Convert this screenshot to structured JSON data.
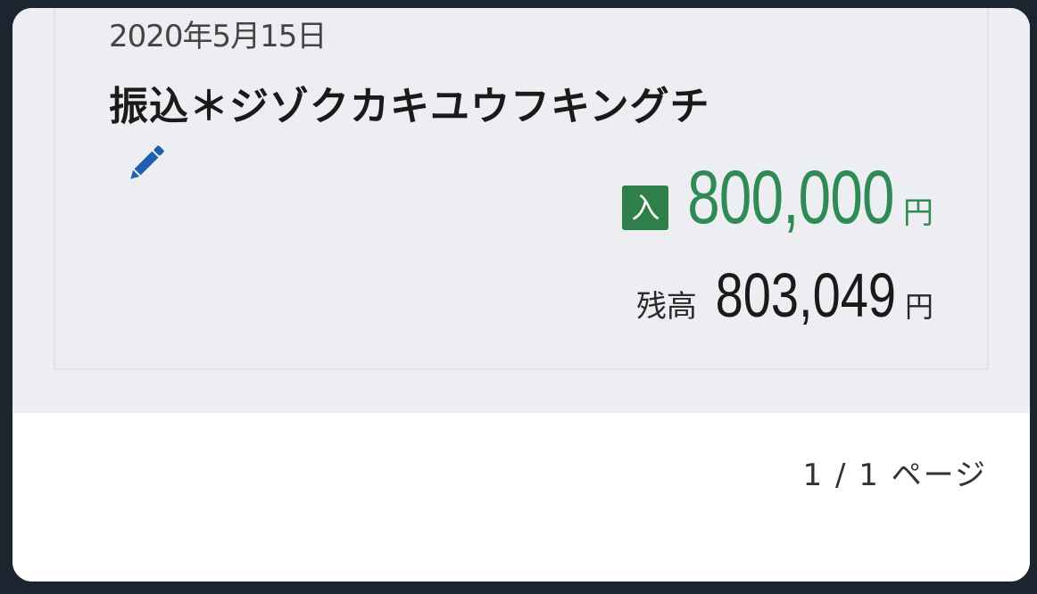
{
  "transaction": {
    "date": "2020年5月15日",
    "description": "振込＊ジゾクカキユウフキングチ",
    "type_badge": "入",
    "amount": "800,000",
    "amount_unit": "円",
    "balance_label": "残高",
    "balance": "803,049",
    "balance_unit": "円"
  },
  "pagination": {
    "label": "1 / 1 ページ"
  },
  "icons": {
    "edit": "pencil-icon"
  },
  "colors": {
    "deposit_green": "#2f8a55",
    "badge_green": "#2f7f4a",
    "edit_blue": "#1f5fb0"
  }
}
